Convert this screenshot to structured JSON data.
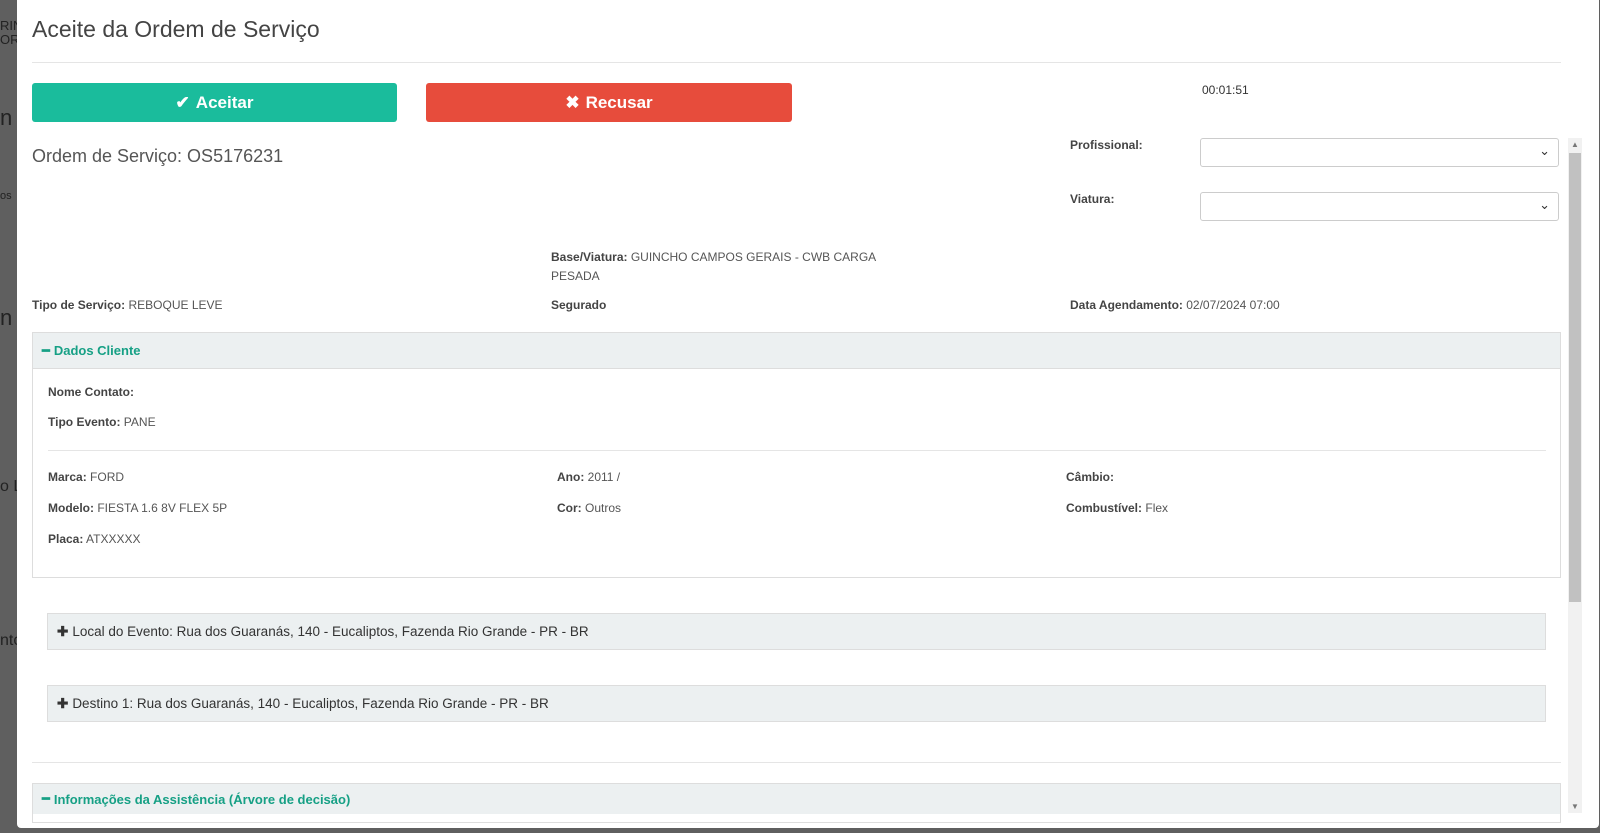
{
  "background_fragments": [
    "RIN",
    "ORA",
    "n",
    "os",
    "n",
    "o L",
    "nto"
  ],
  "modal": {
    "title": "Aceite da Ordem de Serviço",
    "accept_label": "Aceitar",
    "refuse_label": "Recusar",
    "timer": "00:01:51",
    "order_label": "Ordem de Serviço: OS5176231",
    "profissional_label": "Profissional:",
    "profissional_value": "",
    "viatura_label": "Viatura:",
    "viatura_value": "",
    "base_viatura_label": "Base/Viatura:",
    "base_viatura_value": "GUINCHO CAMPOS GERAIS - CWB CARGA",
    "base_viatura_value2": "PESADA",
    "tipo_servico_label": "Tipo de Serviço:",
    "tipo_servico_value": "REBOQUE LEVE",
    "segurado_label": "Segurado",
    "data_agendamento_label": "Data Agendamento:",
    "data_agendamento_value": "02/07/2024 07:00",
    "dados_cliente": {
      "title": "Dados Cliente",
      "nome_contato_label": "Nome Contato:",
      "nome_contato_value": "",
      "tipo_evento_label": "Tipo Evento:",
      "tipo_evento_value": "PANE",
      "marca_label": "Marca:",
      "marca_value": "FORD",
      "modelo_label": "Modelo:",
      "modelo_value": "FIESTA 1.6 8V FLEX 5P",
      "placa_label": "Placa:",
      "placa_value": "ATXXXXX",
      "ano_label": "Ano:",
      "ano_value": "2011 /",
      "cor_label": "Cor:",
      "cor_value": "Outros",
      "cambio_label": "Câmbio:",
      "cambio_value": "",
      "combustivel_label": "Combustível:",
      "combustivel_value": "Flex"
    },
    "local_evento": "Local do Evento: Rua dos Guaranás, 140 - Eucaliptos, Fazenda Rio Grande - PR - BR",
    "destino": "Destino 1: Rua dos Guaranás, 140 - Eucaliptos, Fazenda Rio Grande - PR - BR",
    "info_assistencia": "Informações da Assistência (Árvore de decisão)"
  },
  "colors": {
    "accept": "#1abc9c",
    "refuse": "#e74c3c",
    "panel_title": "#16a085",
    "panel_bg": "#ecf0f1"
  }
}
